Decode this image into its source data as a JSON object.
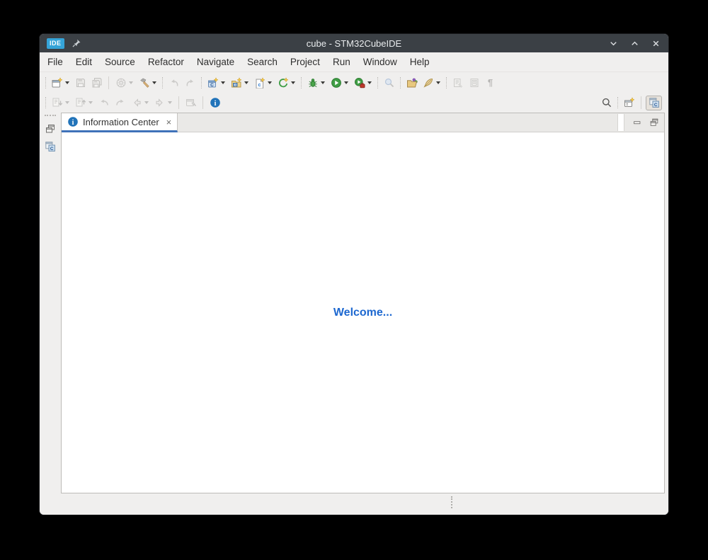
{
  "window": {
    "title": "cube - STM32CubeIDE",
    "badge": "IDE",
    "controls": [
      {
        "name": "window-minimize-button",
        "icon": "chevron-down"
      },
      {
        "name": "window-maximize-button",
        "icon": "chevron-up"
      },
      {
        "name": "window-close-button",
        "icon": "close-x"
      }
    ]
  },
  "menubar": {
    "items": [
      "File",
      "Edit",
      "Source",
      "Refactor",
      "Navigate",
      "Search",
      "Project",
      "Run",
      "Window",
      "Help"
    ]
  },
  "toolbar_main": [
    {
      "type": "sep",
      "dotted": true
    },
    {
      "name": "new-button",
      "icon": "new-wizard",
      "dropdown": true
    },
    {
      "name": "save-button",
      "icon": "save",
      "disabled": true
    },
    {
      "name": "save-all-button",
      "icon": "save-all",
      "disabled": true
    },
    {
      "type": "sep"
    },
    {
      "name": "build-all-button",
      "icon": "wheel",
      "dropdown": true,
      "disabled": true
    },
    {
      "name": "build-button",
      "icon": "hammer",
      "dropdown": true
    },
    {
      "type": "sep",
      "dotted": true
    },
    {
      "name": "undo-button",
      "icon": "undo-curved",
      "disabled": true
    },
    {
      "name": "redo-button",
      "icon": "redo-curved",
      "disabled": true
    },
    {
      "type": "sep",
      "dotted": true
    },
    {
      "name": "new-stm32-project-button",
      "icon": "c-window-new",
      "dropdown": true
    },
    {
      "name": "new-project-button",
      "icon": "c-folder-new",
      "dropdown": true
    },
    {
      "name": "new-c-file-button",
      "icon": "c-file-new",
      "dropdown": true
    },
    {
      "name": "new-launch-config-button",
      "icon": "launch-new",
      "dropdown": true
    },
    {
      "type": "sep",
      "dotted": true
    },
    {
      "name": "debug-button",
      "icon": "debug-bug",
      "dropdown": true
    },
    {
      "name": "run-button",
      "icon": "run-play",
      "dropdown": true
    },
    {
      "name": "external-tools-button",
      "icon": "external-tools",
      "dropdown": true
    },
    {
      "type": "sep",
      "dotted": true
    },
    {
      "name": "c-search-button",
      "icon": "c-search",
      "disabled": true
    },
    {
      "type": "sep",
      "dotted": true
    },
    {
      "name": "open-element-button",
      "icon": "open-element"
    },
    {
      "name": "annotate-button",
      "icon": "feather",
      "dropdown": true
    },
    {
      "type": "sep",
      "dotted": true
    },
    {
      "name": "mark-occurrences-button",
      "icon": "doc-edit",
      "disabled": true
    },
    {
      "name": "show-source-button",
      "icon": "doc-frame",
      "disabled": true
    },
    {
      "name": "show-whitespace-button",
      "icon": "pilcrow",
      "disabled": true
    }
  ],
  "toolbar_nav": [
    {
      "type": "sep",
      "dotted": true
    },
    {
      "name": "next-annotation-button",
      "icon": "annotation-next",
      "dropdown": true,
      "disabled": true
    },
    {
      "name": "previous-annotation-button",
      "icon": "annotation-prev",
      "dropdown": true,
      "disabled": true
    },
    {
      "name": "last-edit-location-button",
      "icon": "back-curved",
      "disabled": true
    },
    {
      "name": "next-edit-location-button",
      "icon": "forward-curved",
      "disabled": true
    },
    {
      "name": "back-button",
      "icon": "back-arrow",
      "dropdown": true,
      "disabled": true
    },
    {
      "name": "forward-button",
      "icon": "forward-arrow",
      "dropdown": true,
      "disabled": true
    },
    {
      "type": "sep"
    },
    {
      "name": "pin-editor-button",
      "icon": "pin-editor",
      "disabled": true
    },
    {
      "type": "sep"
    },
    {
      "name": "information-center-button",
      "icon": "info"
    }
  ],
  "toolbar_nav_right": [
    {
      "name": "find-actions-button",
      "icon": "search"
    },
    {
      "type": "sep",
      "dotted": true
    },
    {
      "name": "open-perspective-button",
      "icon": "perspective-new"
    },
    {
      "type": "sep"
    },
    {
      "name": "cpp-perspective-button",
      "icon": "cpp-perspective",
      "selected": true
    }
  ],
  "side_strip": [
    {
      "name": "restore-views-button",
      "icon": "restore-view"
    },
    {
      "name": "minimized-cpp-view-button",
      "icon": "cpp-perspective"
    }
  ],
  "editor": {
    "tab": {
      "label": "Information Center",
      "icon": "info-icon",
      "close_glyph": "×"
    },
    "welcome": "Welcome...",
    "view_buttons": [
      {
        "name": "minimize-view-button",
        "icon": "minimize-view"
      },
      {
        "name": "maximize-view-button",
        "icon": "restore-view"
      }
    ]
  },
  "colors": {
    "titlebar": "#3b4045",
    "chrome": "#f0efee",
    "badge": "#35a4d8",
    "tabline": "#3f72b9",
    "welcome": "#1d68d0",
    "info_blue": "#2173b9",
    "run_green": "#3f9d45"
  }
}
